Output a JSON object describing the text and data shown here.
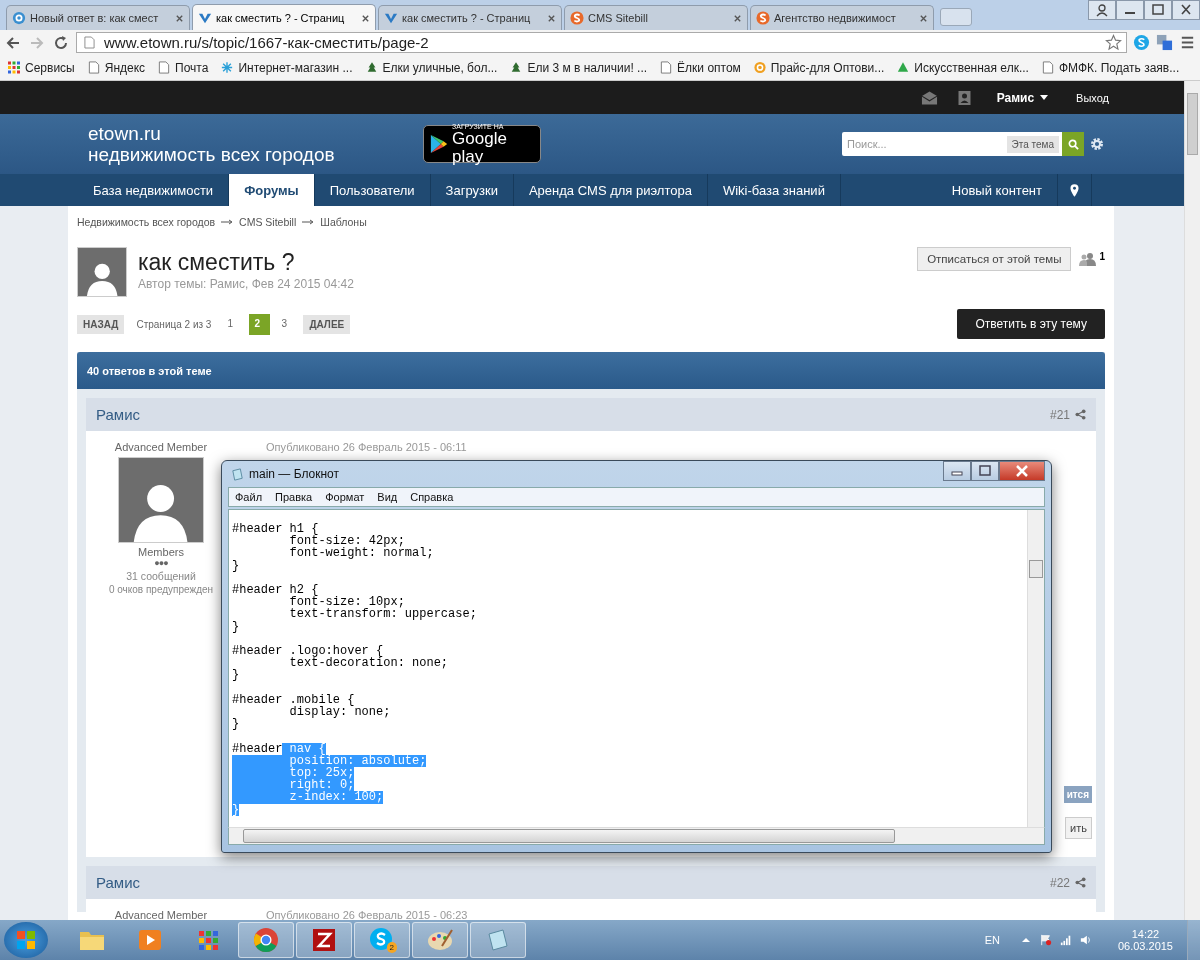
{
  "browser": {
    "tabs": [
      {
        "title": "Новый ответ в: как смест",
        "kind": "at",
        "selected": false
      },
      {
        "title": "как сместить ? - Страниц",
        "kind": "v",
        "selected": true
      },
      {
        "title": "как сместить ? - Страниц",
        "kind": "v",
        "selected": false
      },
      {
        "title": "CMS Sitebill",
        "kind": "s",
        "selected": false
      },
      {
        "title": "Агентство недвижимост",
        "kind": "s",
        "selected": false
      }
    ],
    "address": "www.etown.ru/s/topic/1667-как-сместить/page-2",
    "bookmarks": [
      {
        "label": "Сервисы",
        "kind": "apps"
      },
      {
        "label": "Яндекс",
        "kind": "page"
      },
      {
        "label": "Почта",
        "kind": "page"
      },
      {
        "label": "Интернет-магазин ...",
        "kind": "snowflake"
      },
      {
        "label": "Елки уличные, бол...",
        "kind": "tree"
      },
      {
        "label": "Ели 3 м в наличии! ...",
        "kind": "tree"
      },
      {
        "label": "Ёлки оптом",
        "kind": "page"
      },
      {
        "label": "Прайс-для Оптови...",
        "kind": "at"
      },
      {
        "label": "Искусственная елк...",
        "kind": "triangle"
      },
      {
        "label": "ФМФК. Подать заяв...",
        "kind": "page"
      }
    ]
  },
  "site": {
    "user_bar": {
      "user": "Рамис",
      "logout": "Выход"
    },
    "logo": {
      "line1": "etown.ru",
      "line2": "недвижимость всех городов"
    },
    "store_badge": {
      "caption": "ЗАГРУЗИТЕ НА",
      "name": "Google play"
    },
    "search": {
      "placeholder": "Поиск...",
      "scope": "Эта тема"
    },
    "nav": [
      {
        "label": "База недвижимости",
        "selected": false
      },
      {
        "label": "Форумы",
        "selected": true
      },
      {
        "label": "Пользователи",
        "selected": false
      },
      {
        "label": "Загрузки",
        "selected": false
      },
      {
        "label": "Аренда CMS для риэлтора",
        "selected": false
      },
      {
        "label": "Wiki-база знаний",
        "selected": false
      }
    ],
    "nav_right": "Новый контент",
    "breadcrumbs": [
      "Недвижимость всех городов",
      "CMS Sitebill",
      "Шаблоны"
    ],
    "topic": {
      "title": "как сместить ?",
      "author_line": "Автор темы: Рамис, Фев 24 2015 04:42",
      "unsubscribe": "Отписаться от этой темы",
      "followers": "1"
    },
    "pagination": {
      "prev": "НАЗАД",
      "info": "Страница 2 из 3",
      "pages": [
        {
          "label": "1",
          "selected": false
        },
        {
          "label": "2",
          "selected": true
        },
        {
          "label": "3",
          "selected": false
        }
      ],
      "next": "ДАЛЕЕ"
    },
    "reply_button": "Ответить в эту тему",
    "replies_bar": "40 ответов в этой теме",
    "posts": [
      {
        "author": "Рамис",
        "number": "#21",
        "rank": "Advanced Member",
        "published": "Опубликовано 26 Февраль 2015 - 06:11",
        "group": "Members",
        "pips": "●●●",
        "post_count": "31 сообщений",
        "warnings": "0 очков предупрежден",
        "buttons": [
          "ится",
          "ить"
        ]
      },
      {
        "author": "Рамис",
        "number": "#22",
        "rank": "Advanced Member",
        "published": "Опубликовано 26 Февраль 2015 - 06:23"
      }
    ]
  },
  "notepad": {
    "title": "main — Блокнот",
    "menu": [
      "Файл",
      "Правка",
      "Формат",
      "Вид",
      "Справка"
    ],
    "blocks": [
      {
        "lines": [
          [
            {
              "text": "#header h1 {",
              "selected": false
            }
          ],
          [
            {
              "text": "\tfont-size: 42px;",
              "selected": false
            }
          ],
          [
            {
              "text": "\tfont-weight: normal;",
              "selected": false
            }
          ],
          [
            {
              "text": "}",
              "selected": false
            }
          ]
        ]
      },
      {
        "lines": [
          [
            {
              "text": "#header h2 {",
              "selected": false
            }
          ],
          [
            {
              "text": "\tfont-size: 10px;",
              "selected": false
            }
          ],
          [
            {
              "text": "\ttext-transform: uppercase;",
              "selected": false
            }
          ],
          [
            {
              "text": "}",
              "selected": false
            }
          ]
        ]
      },
      {
        "lines": [
          [
            {
              "text": "#header .logo:hover {",
              "selected": false
            }
          ],
          [
            {
              "text": "\ttext-decoration: none;",
              "selected": false
            }
          ],
          [
            {
              "text": "}",
              "selected": false
            }
          ]
        ]
      },
      {
        "lines": [
          [
            {
              "text": "#header .mobile {",
              "selected": false
            }
          ],
          [
            {
              "text": "\tdisplay: none;",
              "selected": false
            }
          ],
          [
            {
              "text": "}",
              "selected": false
            }
          ]
        ]
      },
      {
        "lines": [
          [
            {
              "text": "#header",
              "selected": false
            },
            {
              "text": " nav {",
              "selected": true
            }
          ],
          [
            {
              "text": "\tposition: absolute;",
              "selected": true
            }
          ],
          [
            {
              "text": "\ttop: 25x;",
              "selected": true
            }
          ],
          [
            {
              "text": "\tright: 0;",
              "selected": true
            }
          ],
          [
            {
              "text": "\tz-index: 100;",
              "selected": true
            }
          ],
          [
            {
              "text": "}",
              "selected": true
            }
          ]
        ]
      }
    ]
  },
  "taskbar": {
    "apps": [
      {
        "kind": "folder",
        "active": false
      },
      {
        "kind": "media",
        "active": false
      },
      {
        "kind": "grid",
        "active": false
      },
      {
        "kind": "browser",
        "active": true
      },
      {
        "kind": "ftp",
        "active": true
      },
      {
        "kind": "chat",
        "active": true,
        "badge": "2"
      },
      {
        "kind": "paint",
        "active": true
      },
      {
        "kind": "notepad",
        "active": true
      }
    ],
    "language": "EN",
    "time": "14:22",
    "date": "06.03.2015"
  }
}
